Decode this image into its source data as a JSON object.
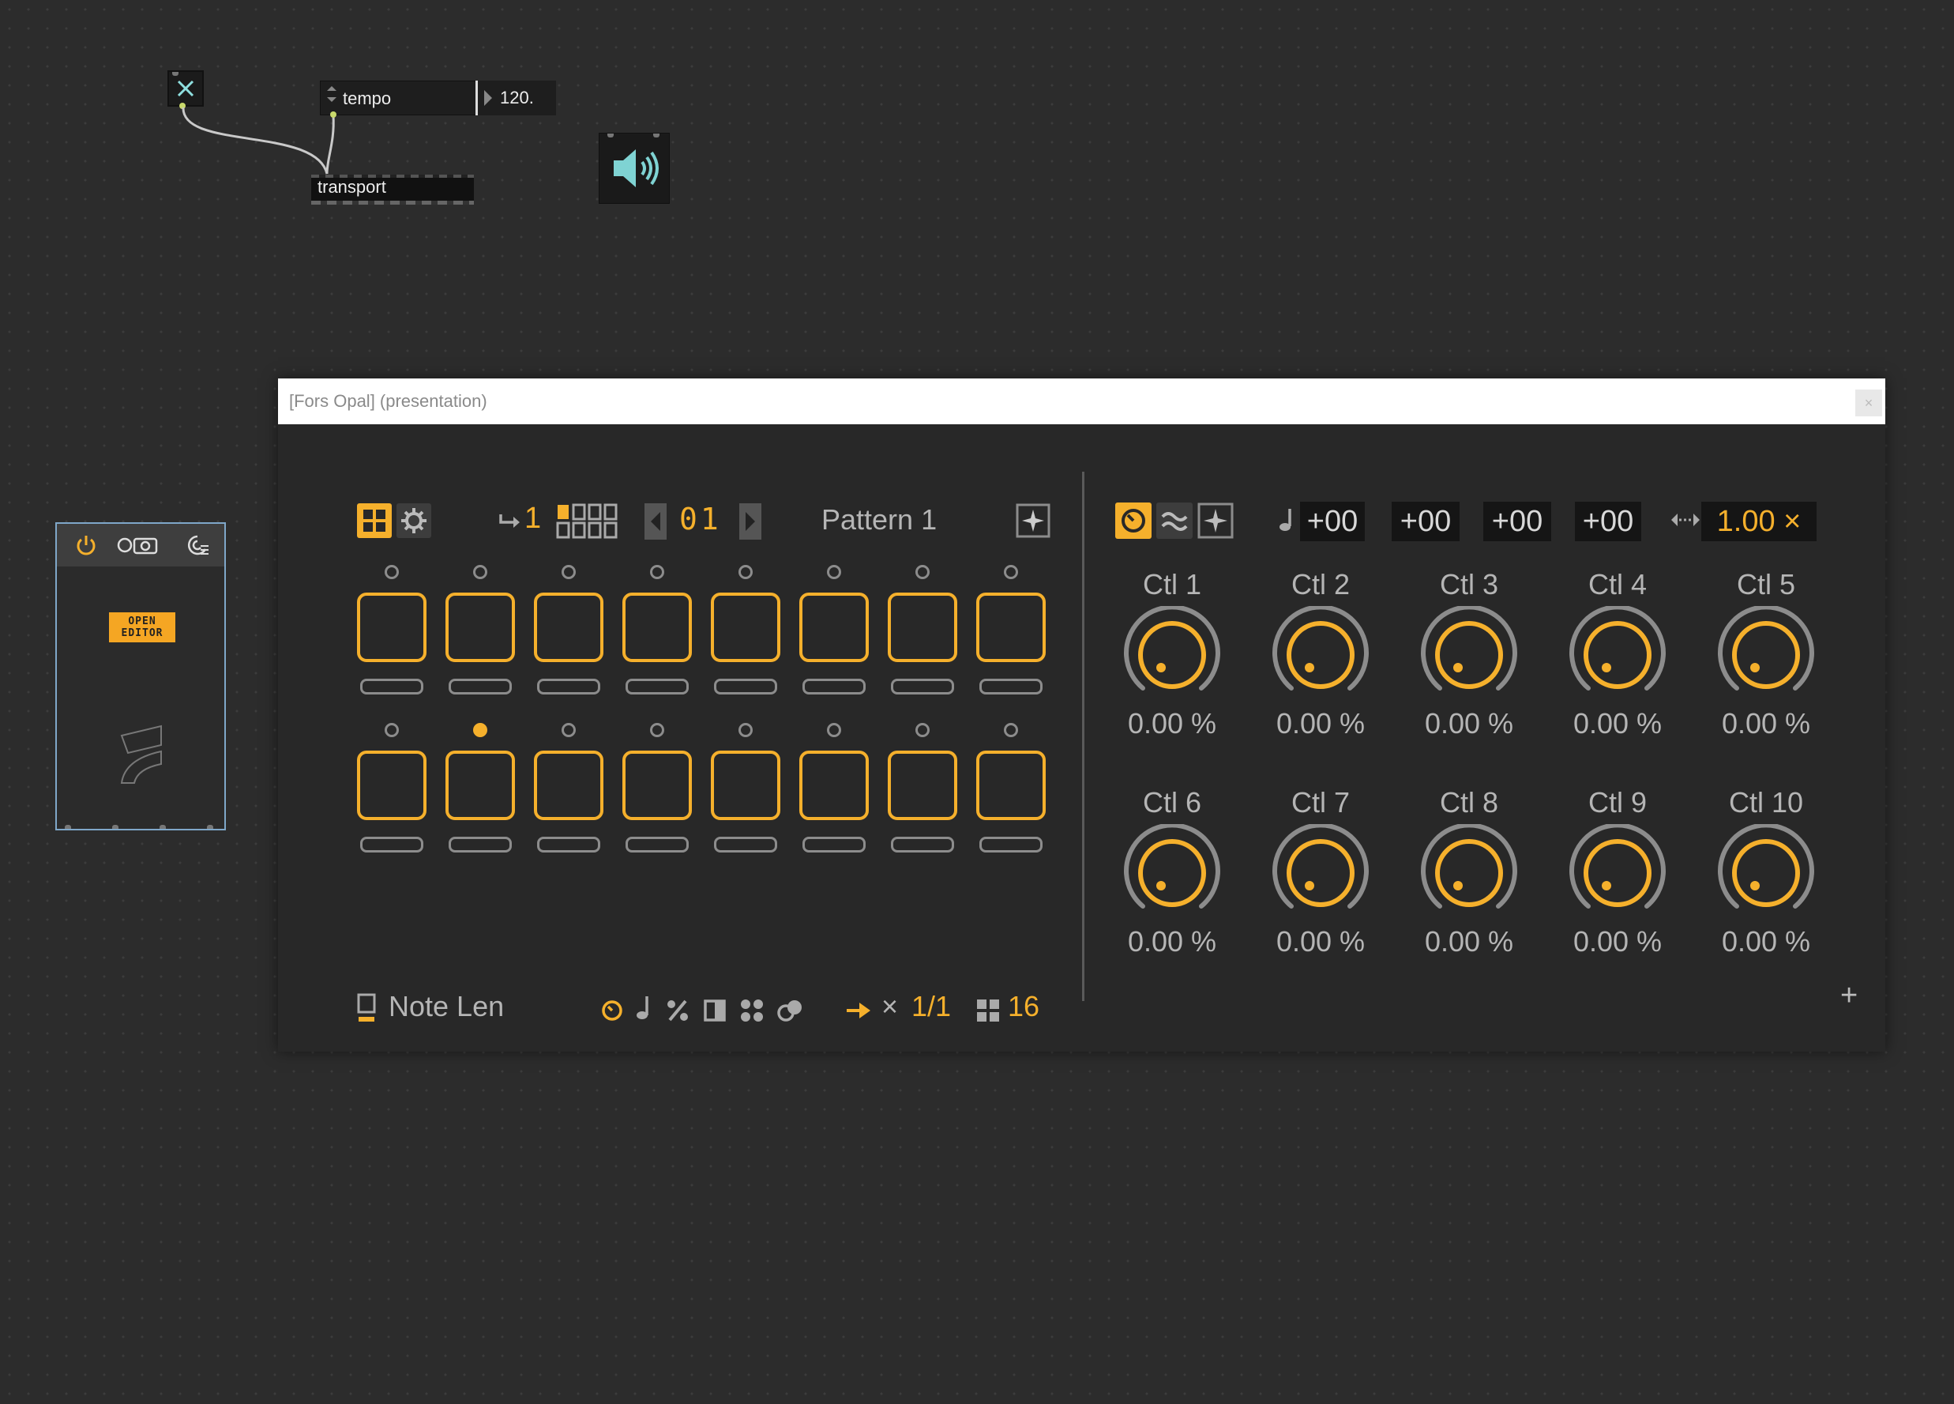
{
  "patcher": {
    "message_label": "tempo",
    "number_value": "120.",
    "transport_label": "transport"
  },
  "device": {
    "open_editor_line1": "OPEN",
    "open_editor_line2": "EDITOR"
  },
  "window": {
    "title": "[Fors Opal] (presentation)",
    "close_glyph": "×"
  },
  "sequencer": {
    "loop_count": "1",
    "pattern_number": "01",
    "pattern_name": "Pattern 1",
    "steps_row1_active_led": [],
    "steps_row2_active_led": [
      1
    ],
    "footer": {
      "param_label": "Note Len",
      "rate": "1/1",
      "rate_prefix": "×",
      "steps": "16"
    }
  },
  "controls": {
    "transpose": [
      "+00",
      "+00",
      "+00",
      "+00"
    ],
    "speed": "1.00 ×",
    "knobs": [
      {
        "label": "Ctl 1",
        "value": "0.00 %"
      },
      {
        "label": "Ctl 2",
        "value": "0.00 %"
      },
      {
        "label": "Ctl 3",
        "value": "0.00 %"
      },
      {
        "label": "Ctl 4",
        "value": "0.00 %"
      },
      {
        "label": "Ctl 5",
        "value": "0.00 %"
      },
      {
        "label": "Ctl 6",
        "value": "0.00 %"
      },
      {
        "label": "Ctl 7",
        "value": "0.00 %"
      },
      {
        "label": "Ctl 8",
        "value": "0.00 %"
      },
      {
        "label": "Ctl 9",
        "value": "0.00 %"
      },
      {
        "label": "Ctl 10",
        "value": "0.00 %"
      }
    ],
    "add_glyph": "+"
  },
  "colors": {
    "accent": "#f5b02c",
    "background": "#2c2c2c",
    "panel": "#282828",
    "inactive": "#8c8c8c",
    "speaker": "#7fd3d3",
    "card_border": "#7fa7c9"
  }
}
